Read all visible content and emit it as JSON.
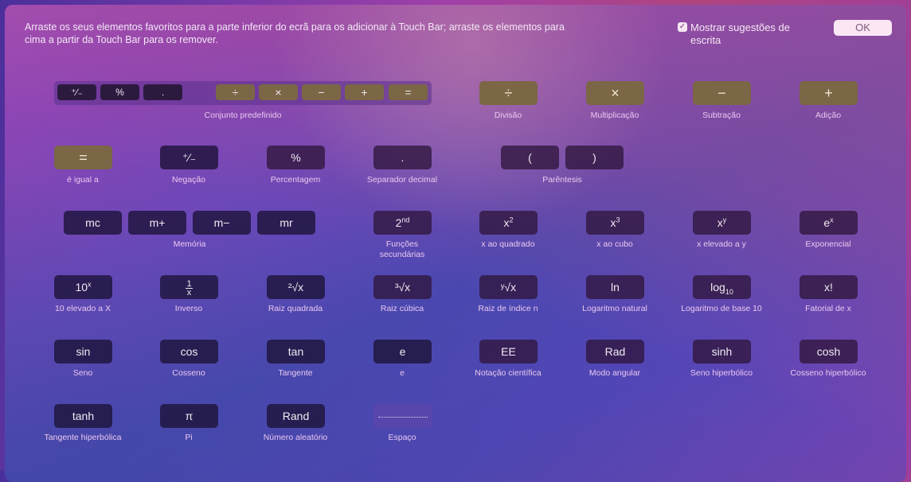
{
  "header": {
    "instruction_line1": "Arraste os seus elementos favoritos para a parte inferior do ecrã para os adicionar à Touch Bar; arraste os elementos para",
    "instruction_line2": "cima a partir da Touch Bar para os remover.",
    "checkbox_label": "Mostrar sugestões de escrita",
    "checkbox_checked": true,
    "checkbox_glyph": "✓",
    "ok_label": "OK"
  },
  "preset": {
    "label": "Conjunto predefinido",
    "keys": [
      "⁺∕₋",
      "%",
      ".",
      "÷",
      "×",
      "−",
      "+",
      "="
    ]
  },
  "items": {
    "divisao": {
      "key": "÷",
      "label": "Divisão"
    },
    "multiplicacao": {
      "key": "×",
      "label": "Multiplicação"
    },
    "subtracao": {
      "key": "−",
      "label": "Subtração"
    },
    "adicao": {
      "key": "+",
      "label": "Adição"
    },
    "igual": {
      "key": "=",
      "label": "é igual a"
    },
    "negacao": {
      "key": "⁺∕₋",
      "label": "Negação"
    },
    "percentagem": {
      "key": "%",
      "label": "Percentagem"
    },
    "separador": {
      "key": ".",
      "label": "Separador decimal"
    },
    "parentesis": {
      "key_open": "(",
      "key_close": ")",
      "label": "Parêntesis"
    },
    "memoria": {
      "keys": [
        "mc",
        "m+",
        "m−",
        "mr"
      ],
      "label": "Memória"
    },
    "secundarias": {
      "key_base": "2",
      "key_sup": "nd",
      "label_line1": "Funções",
      "label_line2": "secundárias"
    },
    "quadrado": {
      "key_base": "x",
      "key_sup": "2",
      "label": "x ao quadrado"
    },
    "cubo": {
      "key_base": "x",
      "key_sup": "3",
      "label": "x ao cubo"
    },
    "elevado_y": {
      "key_base": "x",
      "key_sup": "y",
      "label": "x elevado a y"
    },
    "exponencial": {
      "key_base": "e",
      "key_sup": "x",
      "label": "Exponencial"
    },
    "dez_x": {
      "key_base": "10",
      "key_sup": "x",
      "label": "10 elevado a X"
    },
    "inverso": {
      "key_num": "1",
      "key_den": "x",
      "label": "Inverso"
    },
    "raiz_quadrada": {
      "key": "²√x",
      "label": "Raiz quadrada"
    },
    "raiz_cubica": {
      "key": "³√x",
      "label": "Raiz cúbica"
    },
    "raiz_n": {
      "key": "ʸ√x",
      "label": "Raiz de índice n"
    },
    "ln": {
      "key": "ln",
      "label": "Logaritmo natural"
    },
    "log10": {
      "key_base": "log",
      "key_sub": "10",
      "label": "Logaritmo de base 10"
    },
    "fatorial": {
      "key": "x!",
      "label": "Fatorial de x"
    },
    "sin": {
      "key": "sin",
      "label": "Seno"
    },
    "cos": {
      "key": "cos",
      "label": "Cosseno"
    },
    "tan": {
      "key": "tan",
      "label": "Tangente"
    },
    "e": {
      "key": "e",
      "label": "e"
    },
    "ee": {
      "key": "EE",
      "label": "Notação científica"
    },
    "rad": {
      "key": "Rad",
      "label": "Modo angular"
    },
    "sinh": {
      "key": "sinh",
      "label": "Seno hiperbólico"
    },
    "cosh": {
      "key": "cosh",
      "label": "Cosseno hiperbólico"
    },
    "tanh": {
      "key": "tanh",
      "label": "Tangente hiperbólica"
    },
    "pi": {
      "key": "π",
      "label": "Pi"
    },
    "rand": {
      "key": "Rand",
      "label": "Número aleatório"
    },
    "espaco": {
      "label": "Espaço"
    }
  },
  "colors": {
    "operator_key": "#7b6745",
    "dark_key": "#1e143c",
    "ok_button": "#fbe6f4"
  }
}
